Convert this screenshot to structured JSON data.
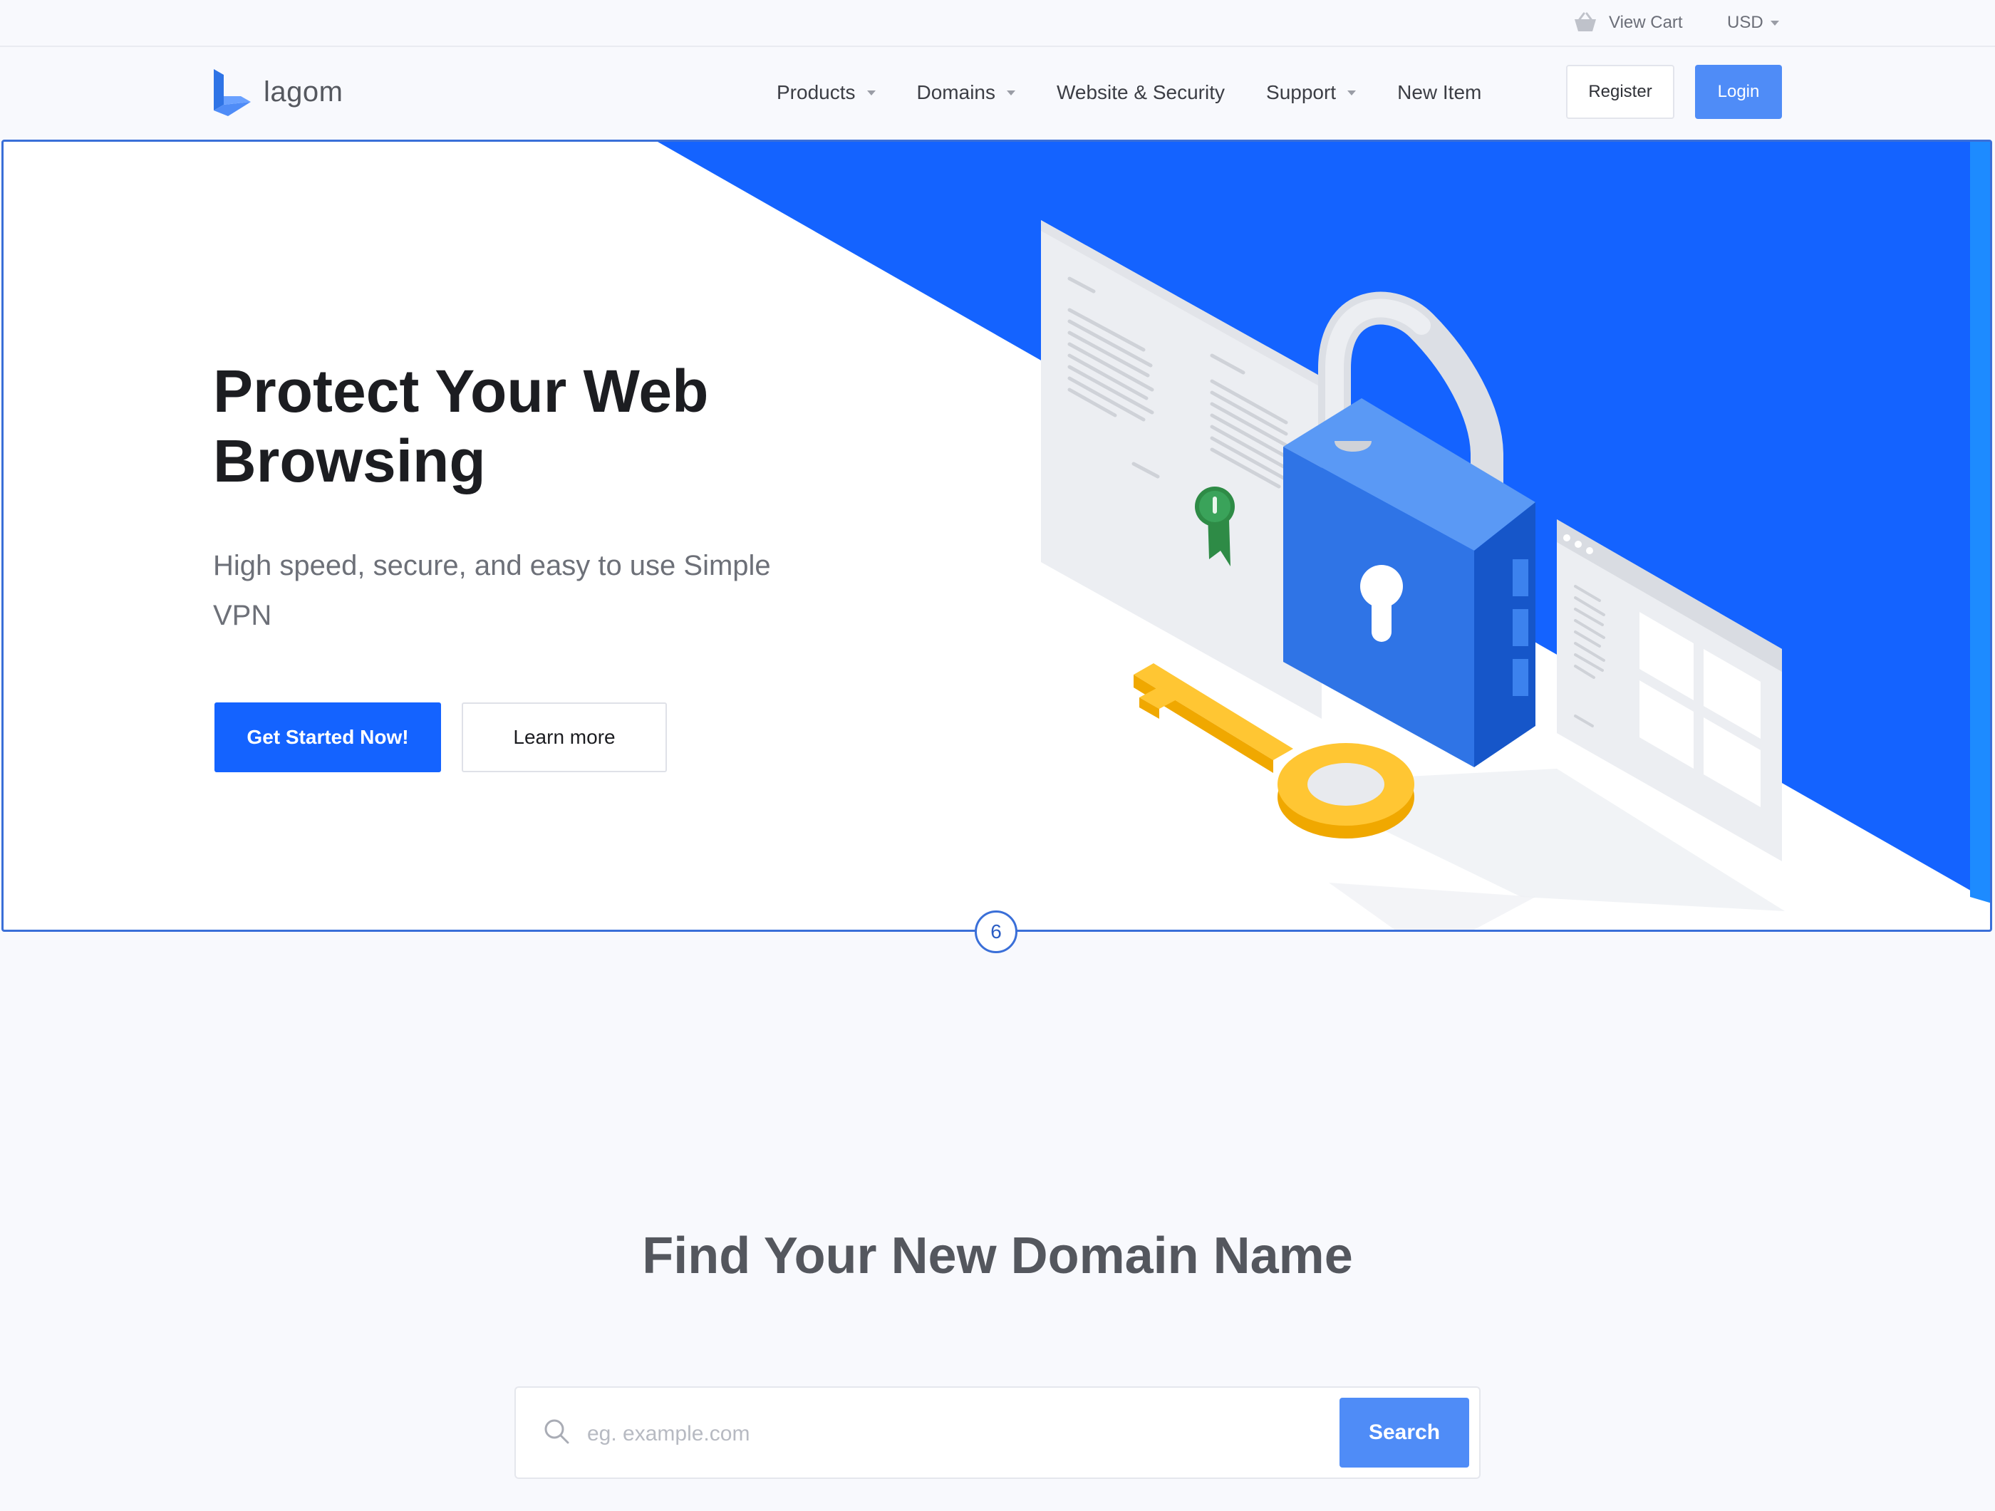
{
  "topbar": {
    "cart_label": "View Cart",
    "currency_label": "USD"
  },
  "brand": {
    "name": "lagom",
    "logo_icon": "lagom-logo-icon"
  },
  "nav": {
    "items": [
      {
        "label": "Products",
        "has_dropdown": true
      },
      {
        "label": "Domains",
        "has_dropdown": true
      },
      {
        "label": "Website & Security",
        "has_dropdown": false
      },
      {
        "label": "Support",
        "has_dropdown": true
      },
      {
        "label": "New Item",
        "has_dropdown": false
      }
    ],
    "register_label": "Register",
    "login_label": "Login"
  },
  "hero": {
    "title_line1": "Protect Your Web",
    "title_line2": "Browsing",
    "subtitle_line1": "High speed, secure, and easy to use Simple",
    "subtitle_line2": "VPN",
    "primary_cta": "Get Started Now!",
    "secondary_cta": "Learn more",
    "slide_number": "6",
    "illustration_icons": [
      "padlock-icon",
      "key-icon",
      "certificate-icon",
      "browser-window-icon"
    ]
  },
  "domain_search": {
    "title": "Find Your New Domain Name",
    "placeholder": "eg. example.com",
    "button_label": "Search"
  },
  "colors": {
    "primary": "#1463ff",
    "accent_button": "#4f8cf7",
    "hero_outline": "#3a6fd8",
    "key_yellow": "#ffc633",
    "padlock_blue": "#2f74e6"
  }
}
